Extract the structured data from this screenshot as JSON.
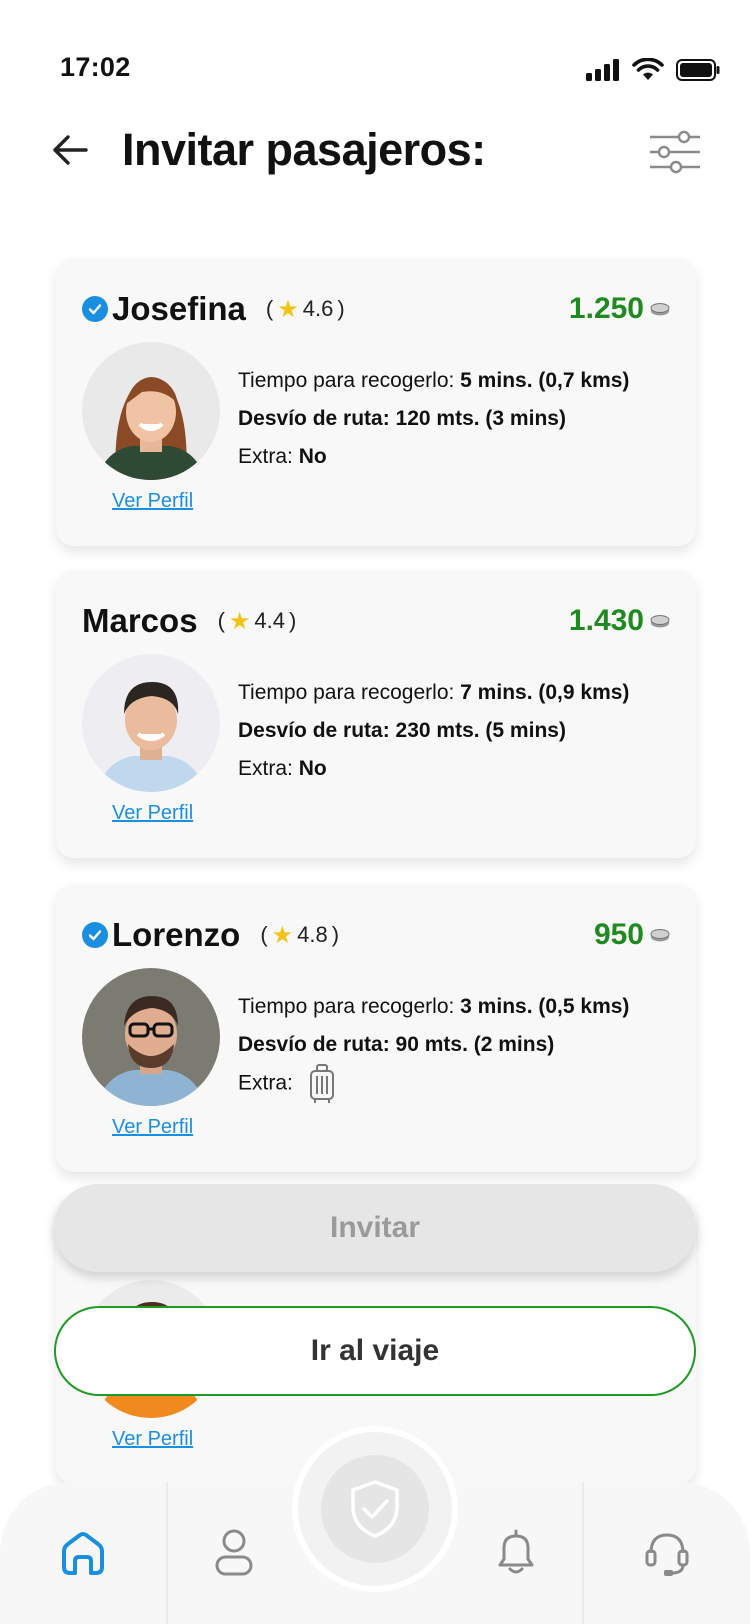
{
  "status_bar": {
    "time": "17:02"
  },
  "header": {
    "title": "Invitar pasajeros:"
  },
  "passengers": [
    {
      "name": "Josefina",
      "verified": true,
      "rating": "4.6",
      "price": "1.250",
      "pickup_label": "Tiempo para recogerlo: ",
      "pickup_value": "5 mins. (0,7 kms)",
      "detour": "Desvío de ruta: 120 mts. (3 mins)",
      "extra_label": "Extra: ",
      "extra_value": "No",
      "profile_link": "Ver Perfil"
    },
    {
      "name": "Marcos",
      "verified": false,
      "rating": "4.4",
      "price": "1.430",
      "pickup_label": "Tiempo para recogerlo: ",
      "pickup_value": "7 mins. (0,9 kms)",
      "detour": "Desvío de ruta: 230 mts. (5 mins)",
      "extra_label": "Extra: ",
      "extra_value": "No",
      "profile_link": "Ver Perfil"
    },
    {
      "name": "Lorenzo",
      "verified": true,
      "rating": "4.8",
      "price": "950",
      "pickup_label": "Tiempo para recogerlo: ",
      "pickup_value": "3 mins. (0,5 kms)",
      "detour": "Desvío de ruta: 90 mts. (2 mins)",
      "extra_label": "Extra:",
      "extra_icon": "luggage-icon",
      "profile_link": "Ver Perfil"
    },
    {
      "profile_link": "Ver Perfil"
    }
  ],
  "actions": {
    "invite": "Invitar",
    "go_trip": "Ir al viaje"
  },
  "bottom_nav": {
    "items": [
      "home-icon",
      "profile-icon",
      "shield-check-icon",
      "bell-icon",
      "headset-icon"
    ]
  },
  "colors": {
    "price_green": "#1f8a20",
    "link_blue": "#1a8fe0",
    "verified_blue": "#1a8fe0",
    "star_yellow": "#f2c418",
    "trip_border": "#1f9a22"
  }
}
